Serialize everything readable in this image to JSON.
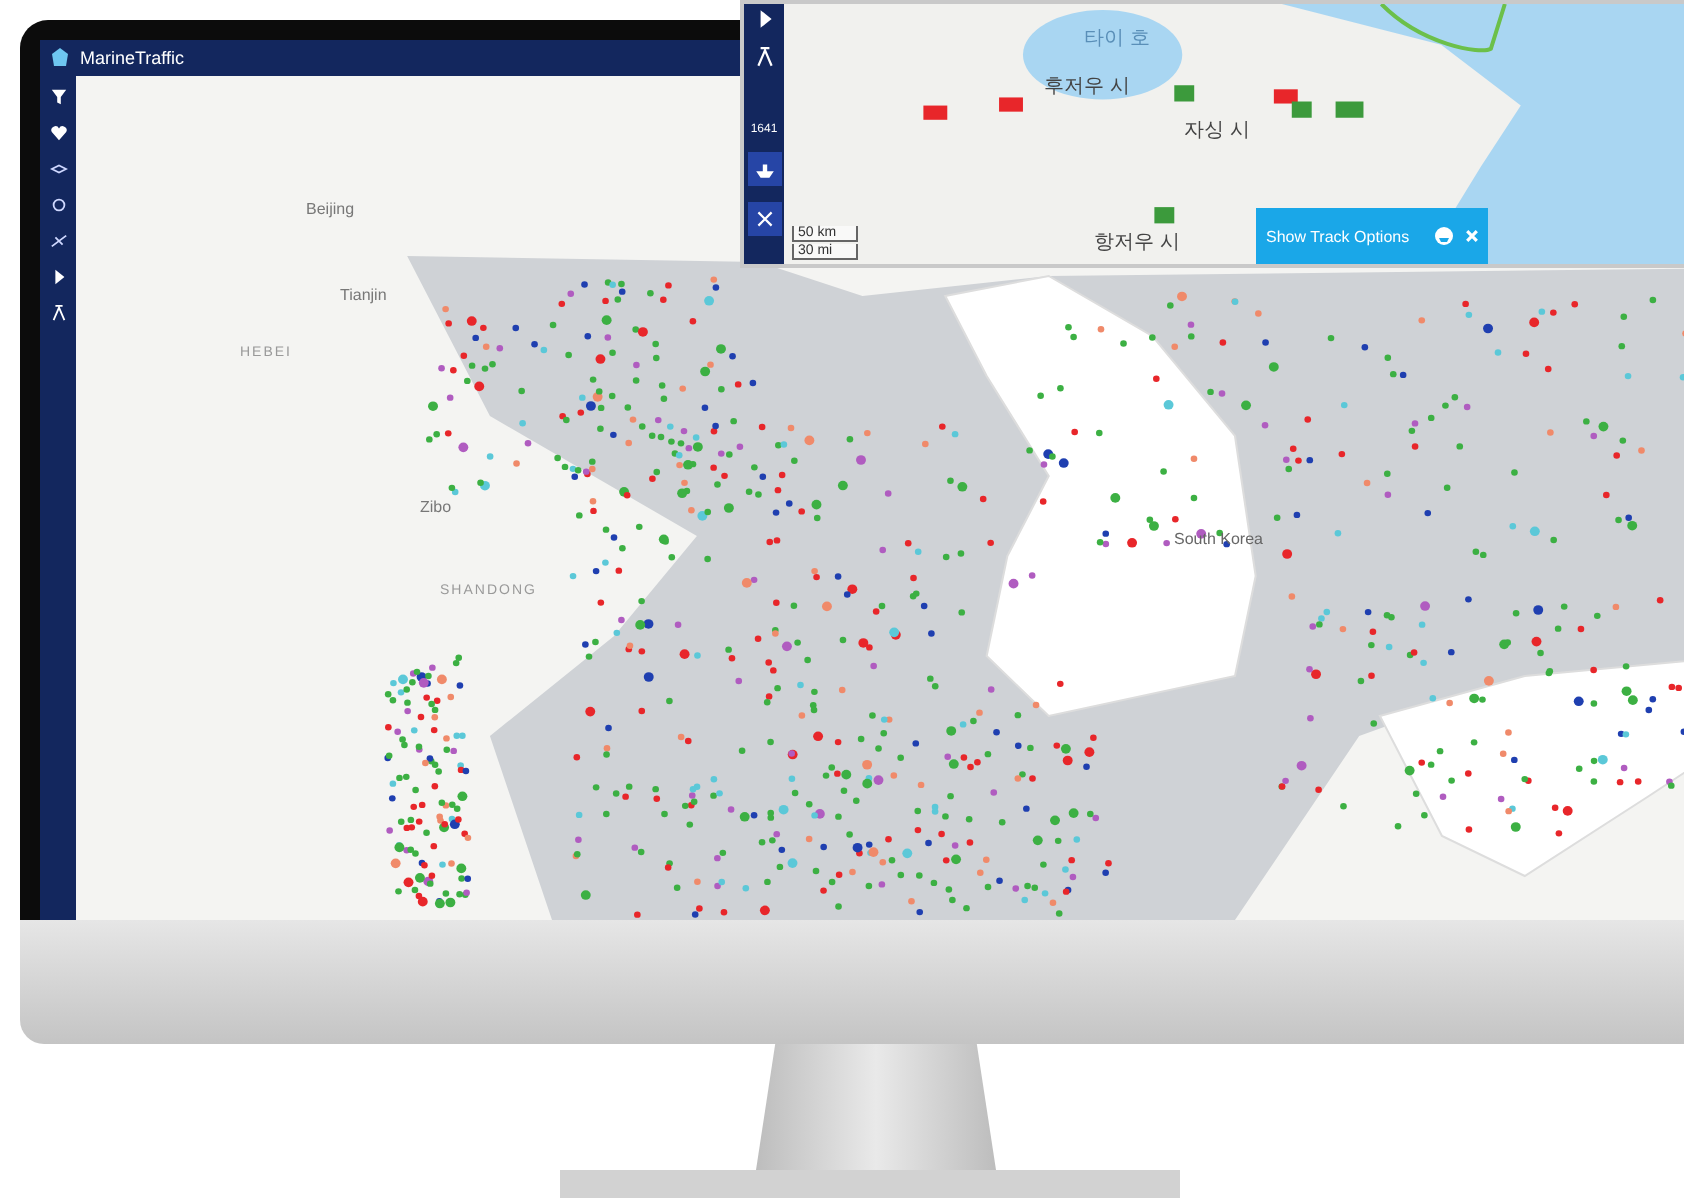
{
  "app": {
    "title": "MarineTraffic"
  },
  "map": {
    "labels": [
      {
        "text": "Beijing",
        "kind": "city"
      },
      {
        "text": "Tianjin",
        "kind": "city"
      },
      {
        "text": "HEBEI",
        "kind": "region"
      },
      {
        "text": "Zibo",
        "kind": "city"
      },
      {
        "text": "SHANDONG",
        "kind": "region"
      },
      {
        "text": "South Korea",
        "kind": "country"
      }
    ]
  },
  "track_window": {
    "vessel_count": "1641",
    "labels": [
      {
        "text": "타이 호",
        "kind": "lake"
      },
      {
        "text": "후저우 시",
        "kind": "city"
      },
      {
        "text": "자싱 시",
        "kind": "city"
      },
      {
        "text": "항저우 시",
        "kind": "city"
      }
    ],
    "scale": [
      "50 km",
      "30 mi"
    ],
    "button": "Show Track Options"
  }
}
